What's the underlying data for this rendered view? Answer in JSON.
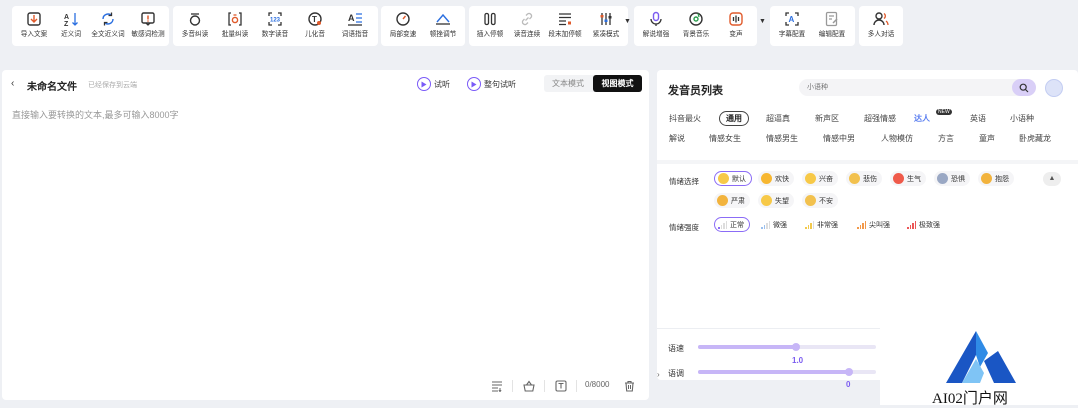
{
  "toolbar": {
    "import_doc": "导入文案",
    "synonym": "近义词",
    "full_synonym": "全文近义词",
    "sensitive": "敏感词检测",
    "polyphone": "多音纠读",
    "batch_correct": "批量纠读",
    "digit_read": "数字读音",
    "erhua": "儿化音",
    "idiom": "词语指音",
    "local_speed": "局部变速",
    "pause_adjust": "顿挫调节",
    "insert_pause": "插入停顿",
    "continuous": "读音连续",
    "para_end_pause": "段末加停顿",
    "compact": "紧凑模式",
    "commentary": "解说增强",
    "bgm": "背景音乐",
    "voice_change": "变声",
    "subtitle_config": "字幕配置",
    "edit_config": "编辑配置",
    "multi_dialog": "多人对话"
  },
  "editor": {
    "back": "‹",
    "file_name": "未命名文件",
    "save_status": "已经保存到云端",
    "preview": "试听",
    "sentence_preview": "整句试听",
    "mode_text": "文本模式",
    "mode_view": "视图模式",
    "placeholder": "直接输入要转换的文本,最多可输入8000字",
    "char_count": "0/8000"
  },
  "panel": {
    "title": "发音员列表",
    "search_placeholder": "小语种",
    "categories_row1": [
      "抖音最火",
      "通用",
      "超逼真",
      "新声区",
      "超强情感",
      "达人",
      "英语",
      "小语种"
    ],
    "categories_row2": [
      "解说",
      "情感女生",
      "情感男生",
      "情感中男",
      "人物模仿",
      "方言",
      "童声",
      "卧虎藏龙"
    ],
    "selected_category": "通用",
    "daren_new_badge": "NEW",
    "emotion_label": "情绪选择",
    "emotions": [
      "默认",
      "欢快",
      "兴奋",
      "悲伤",
      "生气",
      "恐惧",
      "抱怨",
      "严肃",
      "失望",
      "不安"
    ],
    "intensity_label": "情绪强度",
    "intensities": [
      "正常",
      "微强",
      "非常强",
      "尖叫强",
      "极致强"
    ],
    "speed_label": "语速",
    "speed_value": "1.0",
    "speed_fraction": 0.55,
    "pitch_label": "语调",
    "pitch_value": "0",
    "pitch_fraction": 0.85
  },
  "watermark": {
    "text": "AI02门户网"
  },
  "colors": {
    "accent": "#7b5cf0",
    "accent_light": "#c7b6f7",
    "dark": "#111111"
  }
}
